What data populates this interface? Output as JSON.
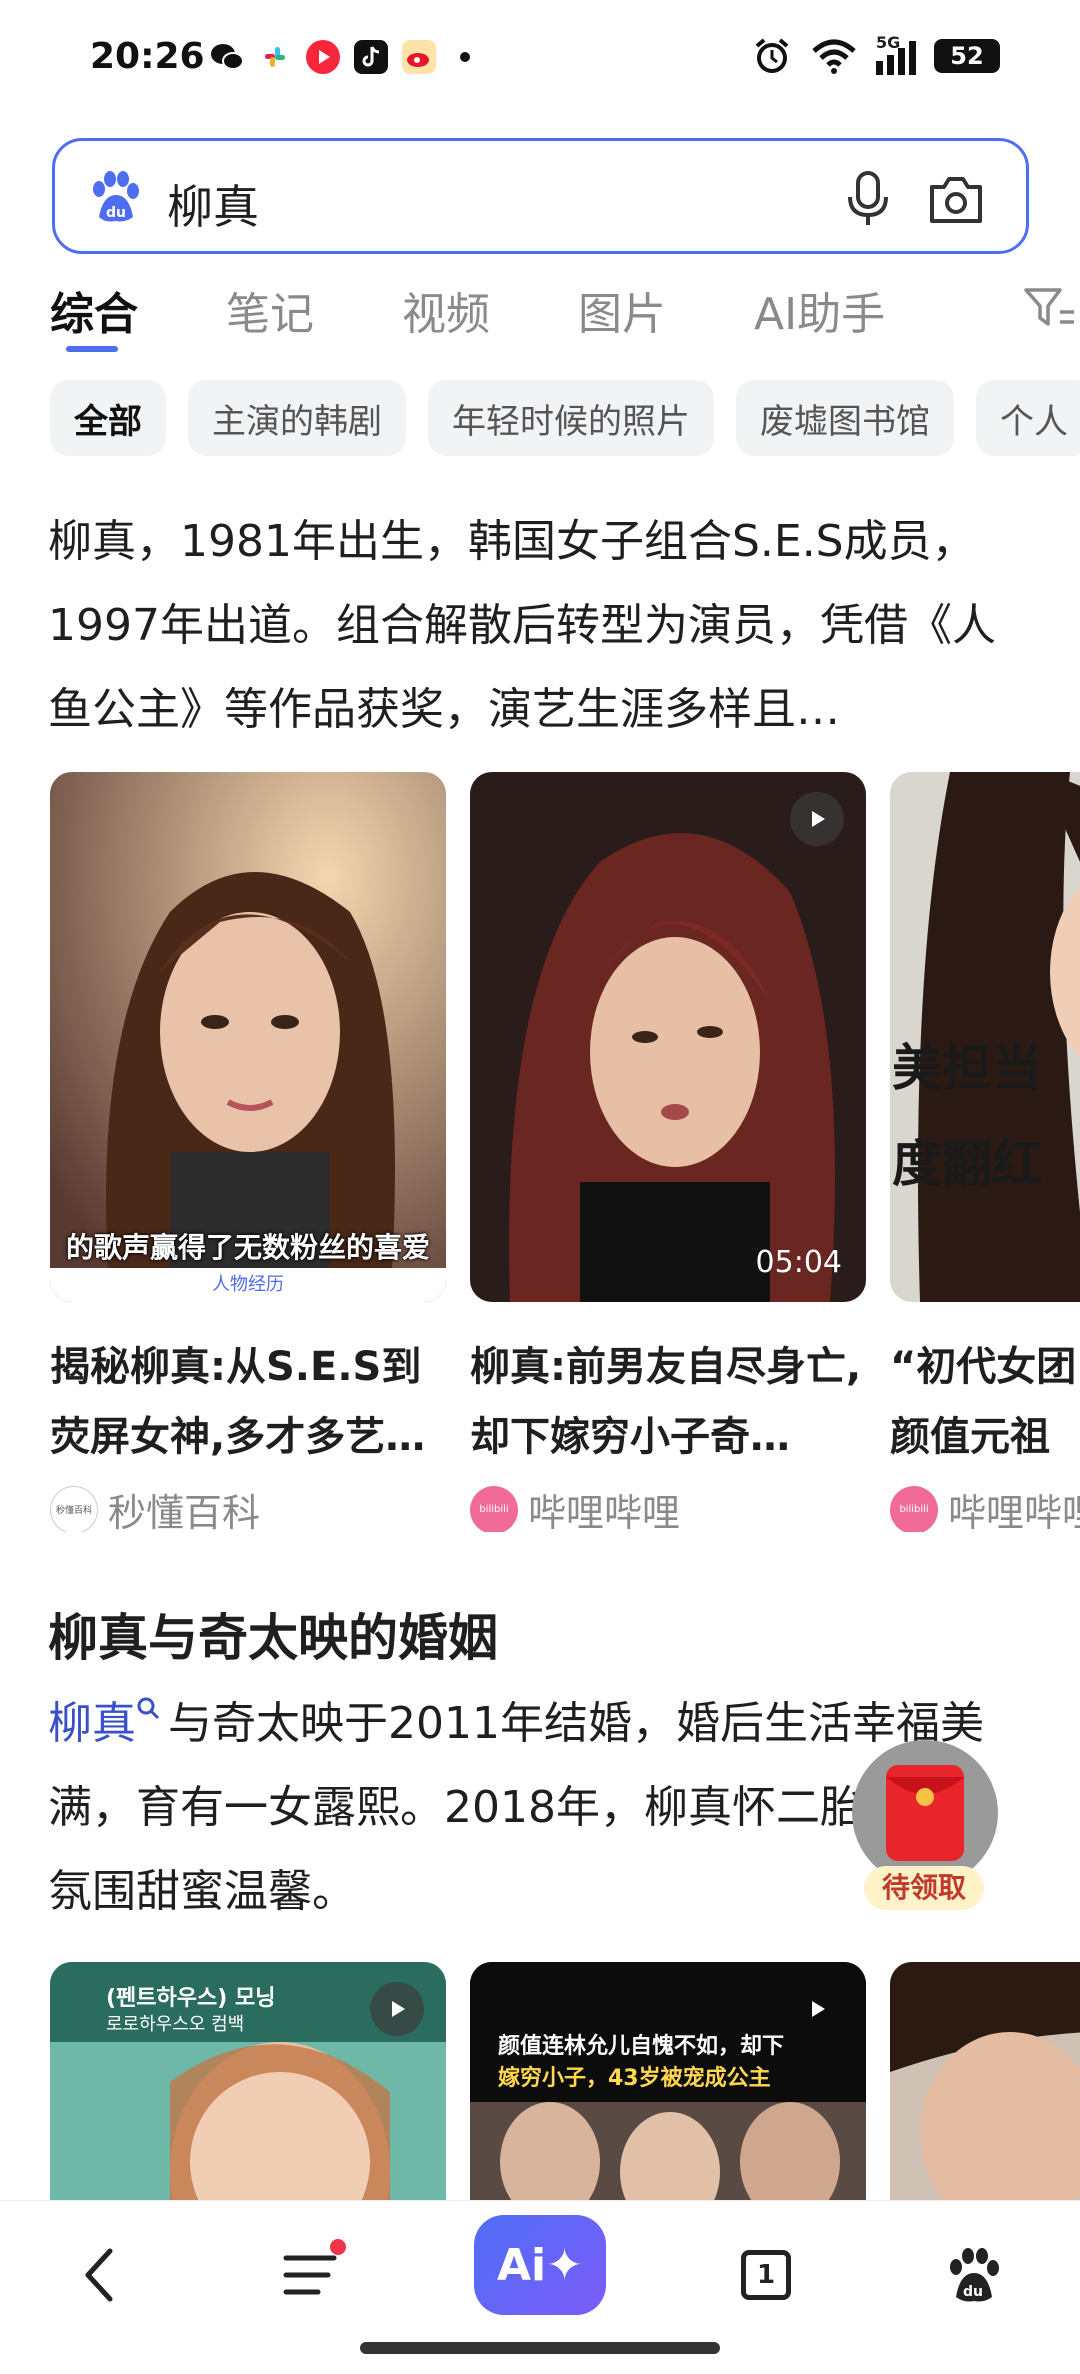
{
  "status_bar": {
    "time": "20:26",
    "network": "5G",
    "battery": "52",
    "app_icons": [
      "wechat-icon",
      "slack-icon",
      "music-icon",
      "tiktok-icon",
      "weibo-icon",
      "more-dot-icon"
    ]
  },
  "search": {
    "query": "柳真"
  },
  "tabs": [
    {
      "label": "综合",
      "active": true
    },
    {
      "label": "笔记"
    },
    {
      "label": "视频"
    },
    {
      "label": "图片"
    },
    {
      "label": "AI助手"
    }
  ],
  "chips": [
    "全部",
    "主演的韩剧",
    "年轻时候的照片",
    "废墟图书馆",
    "个人"
  ],
  "intro": "柳真，1981年出生，韩国女子组合S.E.S成员，1997年出道。组合解散后转型为演员，凭借《人鱼公主》等作品获奖，演艺生涯多样且…",
  "cards": [
    {
      "caption": "的歌声赢得了无数粉丝的喜爱",
      "sub_caption": "人物经历",
      "title": "揭秘柳真:从S.E.S到荧屏女神,多才多艺…",
      "source": "秒懂百科",
      "source_avatar_text": "秒懂百科"
    },
    {
      "duration": "05:04",
      "title": "柳真:前男友自尽身亡,却下嫁穷小子奇…",
      "source": "哔哩哔哩",
      "source_avatar_text": "bilibili"
    },
    {
      "overlay_line1": "美担当",
      "overlay_line2": "度翻红",
      "title": "“初代女团颜值元祖女团S.E.S",
      "source": "哔哩哔哩",
      "source_avatar_text": "bilibili"
    }
  ],
  "section": {
    "title": "柳真与奇太映的婚姻",
    "entity": "柳真",
    "body": "与奇太映于2011年结婚，婚后生活幸福美满，育有一女露熙。2018年，柳真怀二胎，家庭氛围甜蜜温馨。"
  },
  "red_packet": {
    "label": "待领取"
  },
  "cards2": [
    {
      "badge": "(펜트하우스) 모닝",
      "sub": "로로하우스오 컴백"
    },
    {
      "overlay_line1": "颜值连林允儿自愧不如，却下",
      "overlay_line2": "嫁穷小子，43岁被宠成公主"
    },
    {}
  ],
  "bottom_nav": {
    "ai_label": "Ai✦",
    "tab_count": "1"
  },
  "colors": {
    "accent": "#4e6ef2",
    "text": "#1f1f1f",
    "muted": "#8a8a8a",
    "chip_bg": "#f2f3f5",
    "red": "#e8252b"
  }
}
